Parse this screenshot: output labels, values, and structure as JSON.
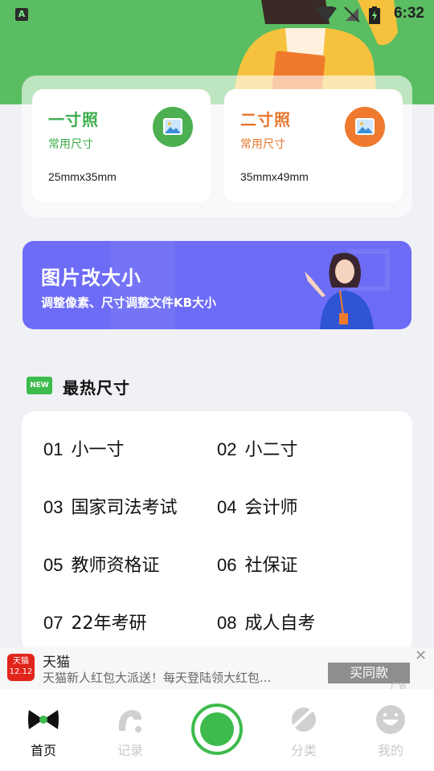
{
  "status": {
    "time": "6:32"
  },
  "cards": [
    {
      "title": "一寸照",
      "subtitle": "常用尺寸",
      "dims": "25mmx35mm",
      "color": "#3dac4b",
      "icon_bg": "#4caf50"
    },
    {
      "title": "二寸照",
      "subtitle": "常用尺寸",
      "dims": "35mmx49mm",
      "color": "#e8762d",
      "icon_bg": "#ef7a2f"
    }
  ],
  "banner": {
    "title": "图片改大小",
    "subtitle": "调整像素、尺寸调整文件KB大小"
  },
  "hot": {
    "badge": "NEW",
    "title": "最热尺寸",
    "items": [
      {
        "num": "01",
        "label": "小一寸"
      },
      {
        "num": "02",
        "label": "小二寸"
      },
      {
        "num": "03",
        "label": "国家司法考试"
      },
      {
        "num": "04",
        "label": "会计师"
      },
      {
        "num": "05",
        "label": "教师资格证"
      },
      {
        "num": "06",
        "label": "社保证"
      },
      {
        "num": "07",
        "label": "22年考研"
      },
      {
        "num": "08",
        "label": "成人自考"
      }
    ]
  },
  "ad": {
    "logo_line1": "天猫",
    "logo_line2": "12.12",
    "name": "天猫",
    "description": "天猫新人红包大派送！每天登陆领大红包...",
    "button": "买同款",
    "tag": "广告"
  },
  "tabs": [
    {
      "label": "首页",
      "icon": "bow-icon",
      "active": true
    },
    {
      "label": "记录",
      "icon": "record-icon",
      "active": false
    },
    {
      "label": "分类",
      "icon": "category-icon",
      "active": false
    },
    {
      "label": "我的",
      "icon": "profile-icon",
      "active": false
    }
  ]
}
